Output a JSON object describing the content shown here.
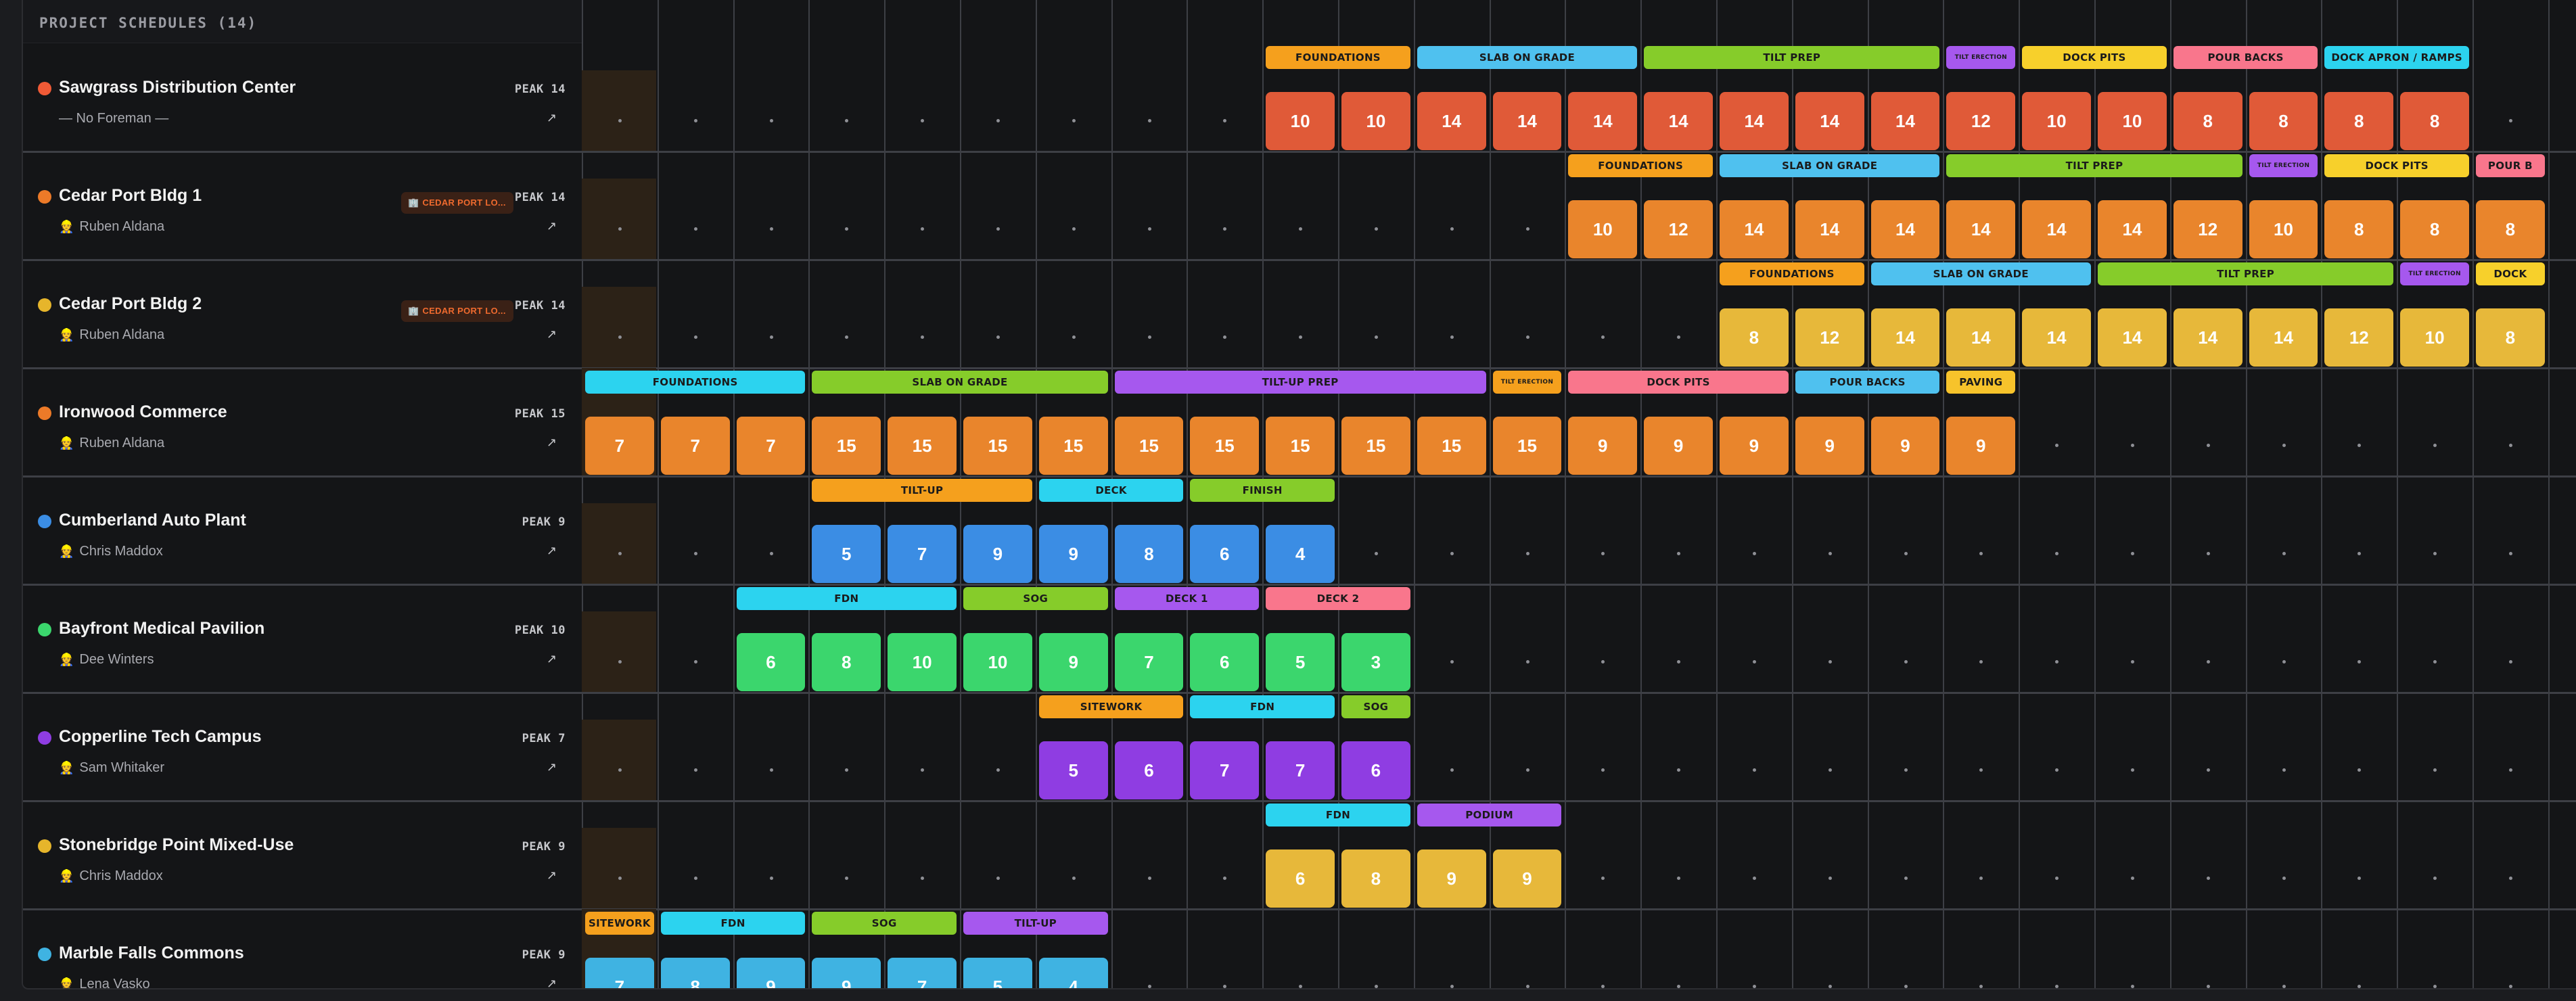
{
  "header": {
    "title": "PROJECT SCHEDULES (14)"
  },
  "colors": {
    "foundations": "#f5a01d",
    "slab": "#4fc1ef",
    "tilt": "#86cc2a",
    "erection": "#a658ee",
    "dock": "#f7d02b",
    "pour": "#f9768c",
    "apron": "#2cd3ef",
    "paving": "#f7c32b",
    "red": "#e05a38",
    "orange": "#e9852c",
    "yellow": "#e7b83a",
    "blue": "#3b8de4",
    "green": "#3bd66d",
    "purple": "#8f3de2",
    "cyan": "#3fb3e2"
  },
  "rows": [
    {
      "name": "Sawgrass Distribution Center",
      "foreman": "— No Foreman —",
      "has_icon": false,
      "dot": "#f05a36",
      "peak": "PEAK 14",
      "link": "↗",
      "badge": null,
      "color": "#e05a38",
      "today": false,
      "values": [
        null,
        null,
        null,
        null,
        null,
        null,
        null,
        null,
        null,
        10,
        10,
        14,
        14,
        14,
        14,
        14,
        14,
        14,
        12,
        10,
        10,
        8,
        8,
        8,
        8,
        null
      ],
      "phases": [
        {
          "label": "FOUNDATIONS",
          "start": 9,
          "span": 2,
          "color": "#f5a01d"
        },
        {
          "label": "SLAB ON GRADE",
          "start": 11,
          "span": 3,
          "color": "#4fc1ef"
        },
        {
          "label": "TILT PREP",
          "start": 14,
          "span": 4,
          "color": "#86cc2a"
        },
        {
          "label": "TILT ERECTION",
          "start": 18,
          "span": 1,
          "color": "#a658ee",
          "small": true
        },
        {
          "label": "DOCK PITS",
          "start": 19,
          "span": 2,
          "color": "#f7d02b"
        },
        {
          "label": "POUR BACKS",
          "start": 21,
          "span": 2,
          "color": "#f9768c"
        },
        {
          "label": "DOCK APRON / RAMPS",
          "start": 23,
          "span": 2,
          "color": "#2cd3ef"
        }
      ]
    },
    {
      "name": "Cedar Port Bldg 1",
      "foreman": "Ruben Aldana",
      "has_icon": true,
      "dot": "#ec7a28",
      "peak": "PEAK 14",
      "link": "↗",
      "badge": "CEDAR PORT LO...",
      "color": "#e9852c",
      "today": false,
      "values": [
        null,
        null,
        null,
        null,
        null,
        null,
        null,
        null,
        null,
        null,
        null,
        null,
        null,
        10,
        12,
        14,
        14,
        14,
        14,
        14,
        14,
        12,
        10,
        8,
        8,
        8
      ],
      "phases": [
        {
          "label": "FOUNDATIONS",
          "start": 13,
          "span": 2,
          "color": "#f5a01d"
        },
        {
          "label": "SLAB ON GRADE",
          "start": 15,
          "span": 3,
          "color": "#4fc1ef"
        },
        {
          "label": "TILT PREP",
          "start": 18,
          "span": 4,
          "color": "#86cc2a"
        },
        {
          "label": "TILT ERECTION",
          "start": 22,
          "span": 1,
          "color": "#a658ee",
          "small": true
        },
        {
          "label": "DOCK PITS",
          "start": 23,
          "span": 2,
          "color": "#f7d02b"
        },
        {
          "label": "POUR B",
          "start": 25,
          "span": 1,
          "color": "#f9768c"
        }
      ]
    },
    {
      "name": "Cedar Port Bldg 2",
      "foreman": "Ruben Aldana",
      "has_icon": true,
      "dot": "#e6b52b",
      "peak": "PEAK 14",
      "link": "↗",
      "badge": "CEDAR PORT LO...",
      "color": "#e7b83a",
      "today": false,
      "values": [
        null,
        null,
        null,
        null,
        null,
        null,
        null,
        null,
        null,
        null,
        null,
        null,
        null,
        null,
        null,
        8,
        12,
        14,
        14,
        14,
        14,
        14,
        14,
        12,
        10,
        8
      ],
      "phases": [
        {
          "label": "FOUNDATIONS",
          "start": 15,
          "span": 2,
          "color": "#f5a01d"
        },
        {
          "label": "SLAB ON GRADE",
          "start": 17,
          "span": 3,
          "color": "#4fc1ef"
        },
        {
          "label": "TILT PREP",
          "start": 20,
          "span": 4,
          "color": "#86cc2a"
        },
        {
          "label": "TILT ERECTION",
          "start": 24,
          "span": 1,
          "color": "#a658ee",
          "small": true
        },
        {
          "label": "DOCK",
          "start": 25,
          "span": 1,
          "color": "#f7d02b"
        }
      ]
    },
    {
      "name": "Ironwood Commerce",
      "foreman": "Ruben Aldana",
      "has_icon": true,
      "dot": "#ec7a28",
      "peak": "PEAK 15",
      "link": "↗",
      "badge": null,
      "color": "#e9852c",
      "today": true,
      "values": [
        7,
        7,
        7,
        15,
        15,
        15,
        15,
        15,
        15,
        15,
        15,
        15,
        15,
        9,
        9,
        9,
        9,
        9,
        9,
        null,
        null,
        null,
        null,
        null,
        null,
        null
      ],
      "phases": [
        {
          "label": "FOUNDATIONS",
          "start": 0,
          "span": 3,
          "color": "#2cd3ef"
        },
        {
          "label": "SLAB ON GRADE",
          "start": 3,
          "span": 4,
          "color": "#86cc2a"
        },
        {
          "label": "TILT-UP PREP",
          "start": 7,
          "span": 5,
          "color": "#a658ee"
        },
        {
          "label": "TILT ERECTION",
          "start": 12,
          "span": 1,
          "color": "#f5a01d",
          "small": true
        },
        {
          "label": "DOCK PITS",
          "start": 13,
          "span": 3,
          "color": "#f9768c"
        },
        {
          "label": "POUR BACKS",
          "start": 16,
          "span": 2,
          "color": "#4fc1ef"
        },
        {
          "label": "PAVING",
          "start": 18,
          "span": 1,
          "color": "#f7c32b"
        }
      ]
    },
    {
      "name": "Cumberland Auto Plant",
      "foreman": "Chris Maddox",
      "has_icon": true,
      "dot": "#3b8de4",
      "peak": "PEAK 9",
      "link": "↗",
      "badge": null,
      "color": "#3b8de4",
      "today": false,
      "values": [
        null,
        null,
        null,
        5,
        7,
        9,
        9,
        8,
        6,
        4,
        null,
        null,
        null,
        null,
        null,
        null,
        null,
        null,
        null,
        null,
        null,
        null,
        null,
        null,
        null,
        null
      ],
      "phases": [
        {
          "label": "TILT-UP",
          "start": 3,
          "span": 3,
          "color": "#f5a01d"
        },
        {
          "label": "DECK",
          "start": 6,
          "span": 2,
          "color": "#2cd3ef"
        },
        {
          "label": "FINISH",
          "start": 8,
          "span": 2,
          "color": "#86cc2a"
        }
      ]
    },
    {
      "name": "Bayfront Medical Pavilion",
      "foreman": "Dee Winters",
      "has_icon": true,
      "dot": "#3bd66d",
      "peak": "PEAK 10",
      "link": "↗",
      "badge": null,
      "color": "#3bd66d",
      "today": false,
      "values": [
        null,
        null,
        6,
        8,
        10,
        10,
        9,
        7,
        6,
        5,
        3,
        null,
        null,
        null,
        null,
        null,
        null,
        null,
        null,
        null,
        null,
        null,
        null,
        null,
        null,
        null
      ],
      "phases": [
        {
          "label": "FDN",
          "start": 2,
          "span": 3,
          "color": "#2cd3ef"
        },
        {
          "label": "SOG",
          "start": 5,
          "span": 2,
          "color": "#86cc2a"
        },
        {
          "label": "DECK 1",
          "start": 7,
          "span": 2,
          "color": "#a658ee"
        },
        {
          "label": "DECK 2",
          "start": 9,
          "span": 2,
          "color": "#f9768c"
        }
      ]
    },
    {
      "name": "Copperline Tech Campus",
      "foreman": "Sam Whitaker",
      "has_icon": true,
      "dot": "#8f3de2",
      "peak": "PEAK 7",
      "link": "↗",
      "badge": null,
      "color": "#8f3de2",
      "today": false,
      "values": [
        null,
        null,
        null,
        null,
        null,
        null,
        5,
        6,
        7,
        7,
        6,
        null,
        null,
        null,
        null,
        null,
        null,
        null,
        null,
        null,
        null,
        null,
        null,
        null,
        null,
        null
      ],
      "phases": [
        {
          "label": "SITEWORK",
          "start": 6,
          "span": 2,
          "color": "#f5a01d"
        },
        {
          "label": "FDN",
          "start": 8,
          "span": 2,
          "color": "#2cd3ef"
        },
        {
          "label": "SOG",
          "start": 10,
          "span": 1,
          "color": "#86cc2a"
        }
      ]
    },
    {
      "name": "Stonebridge Point Mixed-Use",
      "foreman": "Chris Maddox",
      "has_icon": true,
      "dot": "#e6b52b",
      "peak": "PEAK 9",
      "link": "↗",
      "badge": null,
      "color": "#e7b83a",
      "today": false,
      "values": [
        null,
        null,
        null,
        null,
        null,
        null,
        null,
        null,
        null,
        6,
        8,
        9,
        9,
        null,
        null,
        null,
        null,
        null,
        null,
        null,
        null,
        null,
        null,
        null,
        null,
        null
      ],
      "phases": [
        {
          "label": "FDN",
          "start": 9,
          "span": 2,
          "color": "#2cd3ef"
        },
        {
          "label": "PODIUM",
          "start": 11,
          "span": 2,
          "color": "#a658ee"
        }
      ]
    },
    {
      "name": "Marble Falls Commons",
      "foreman": "Lena Vasko",
      "has_icon": true,
      "dot": "#3fb3e2",
      "peak": "PEAK 9",
      "link": "↗",
      "badge": null,
      "color": "#3fb3e2",
      "today": true,
      "values": [
        7,
        8,
        9,
        9,
        7,
        5,
        4,
        null,
        null,
        null,
        null,
        null,
        null,
        null,
        null,
        null,
        null,
        null,
        null,
        null,
        null,
        null,
        null,
        null,
        null,
        null
      ],
      "phases": [
        {
          "label": "SITEWORK",
          "start": 0,
          "span": 1,
          "color": "#f5a01d"
        },
        {
          "label": "FDN",
          "start": 1,
          "span": 2,
          "color": "#2cd3ef"
        },
        {
          "label": "SOG",
          "start": 3,
          "span": 2,
          "color": "#86cc2a"
        },
        {
          "label": "TILT-UP",
          "start": 5,
          "span": 2,
          "color": "#a658ee"
        }
      ]
    }
  ]
}
